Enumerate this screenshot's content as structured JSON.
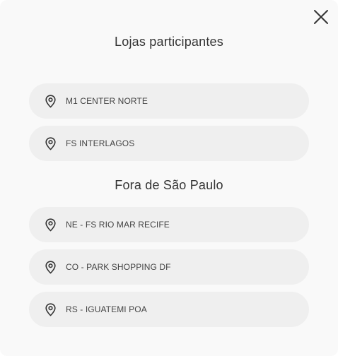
{
  "modal": {
    "close_icon": "close-icon",
    "sections": [
      {
        "title": "Lojas participantes",
        "stores": [
          {
            "label": "M1 CENTER NORTE",
            "icon": "map-pin-icon"
          },
          {
            "label": "FS INTERLAGOS",
            "icon": "map-pin-icon"
          }
        ]
      },
      {
        "title": "Fora de São Paulo",
        "stores": [
          {
            "label": "NE - FS RIO MAR RECIFE",
            "icon": "map-pin-icon"
          },
          {
            "label": "CO - PARK SHOPPING DF",
            "icon": "map-pin-icon"
          },
          {
            "label": "RS - IGUATEMI POA",
            "icon": "map-pin-icon"
          }
        ]
      }
    ]
  },
  "colors": {
    "background": "#f9f9f9",
    "item_background": "#efefef",
    "text": "#333333",
    "icon": "#333333"
  }
}
